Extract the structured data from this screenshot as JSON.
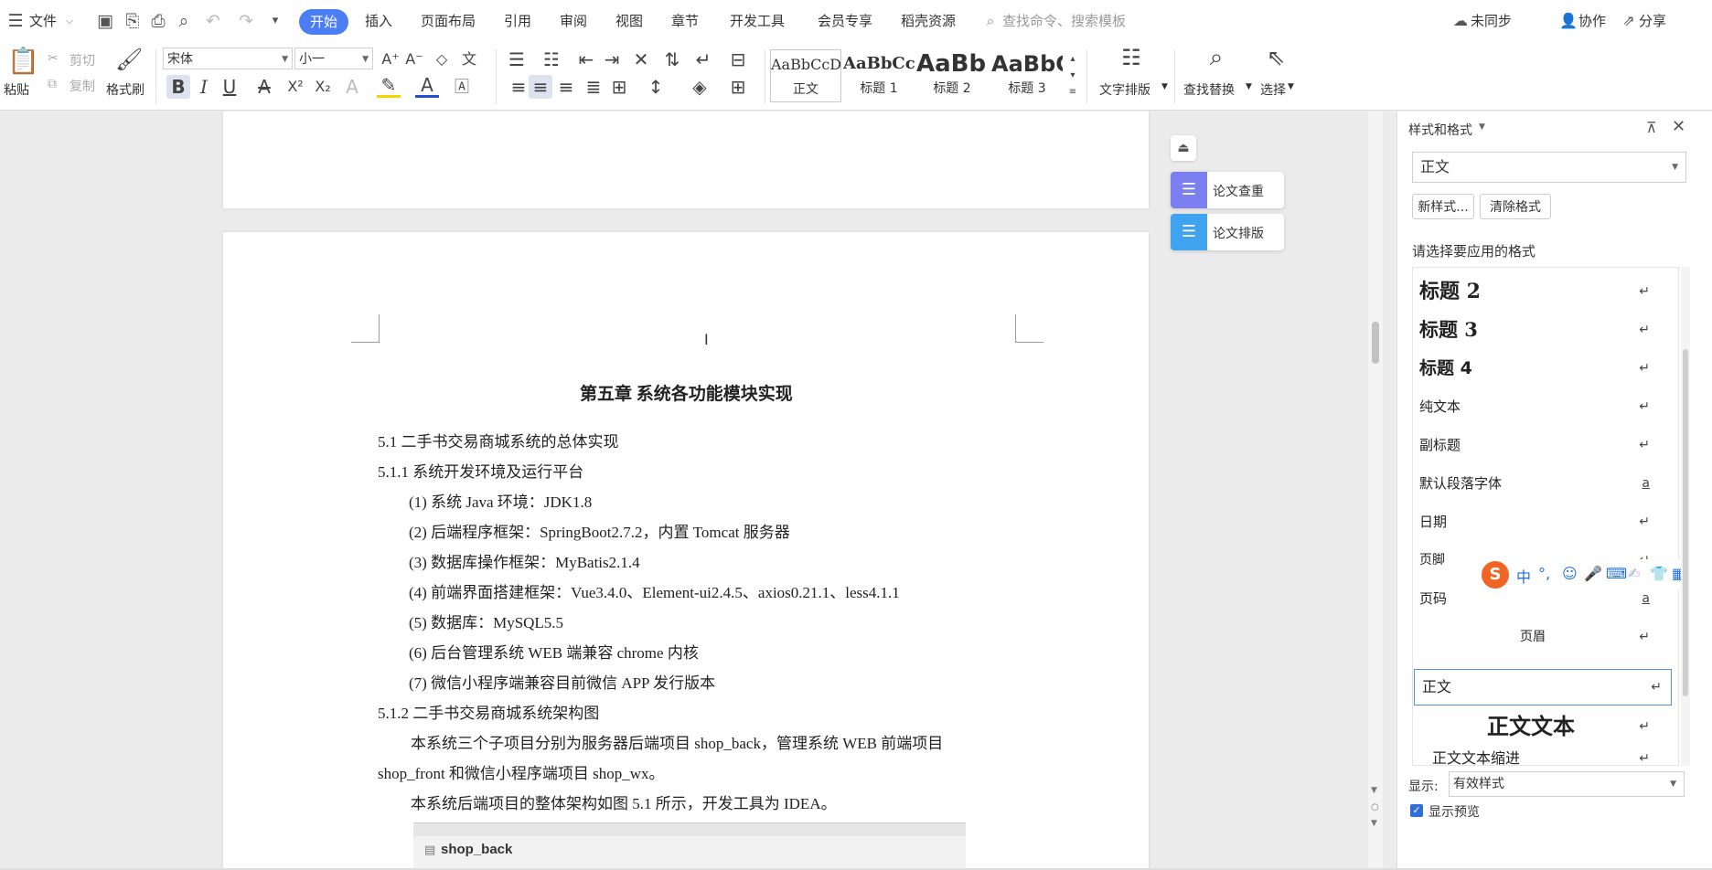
{
  "menubar": {
    "file": "文件",
    "tabs": [
      "开始",
      "插入",
      "页面布局",
      "引用",
      "审阅",
      "视图",
      "章节",
      "开发工具",
      "会员专享",
      "稻壳资源"
    ],
    "search_placeholder": "查找命令、搜索模板",
    "right": {
      "sync": "未同步",
      "collab": "协作",
      "share": "分享"
    }
  },
  "ribbon": {
    "paste": "粘贴",
    "cut": "剪切",
    "copy": "复制",
    "format_painter": "格式刷",
    "font_name": "宋体",
    "font_size": "小一",
    "styles": [
      {
        "preview": "AaBbCcDd",
        "name": "正文"
      },
      {
        "preview": "AaBbCcI",
        "name": "标题 1"
      },
      {
        "preview": "AaBb(",
        "name": "标题 2"
      },
      {
        "preview": "AaBbC",
        "name": "标题 3"
      }
    ],
    "text_layout": "文字排版",
    "find_replace": "查找替换",
    "select": "选择"
  },
  "side_tools": {
    "check": "论文查重",
    "layout": "论文排版"
  },
  "document": {
    "chapter_title": "第五章  系统各功能模块实现",
    "lines": [
      "5.1  二手书交易商城系统的总体实现",
      "5.1.1  系统开发环境及运行平台",
      "(1)  系统 Java 环境：JDK1.8",
      "(2)  后端程序框架：SpringBoot2.7.2，内置 Tomcat 服务器",
      "(3)  数据库操作框架：MyBatis2.1.4",
      "(4)  前端界面搭建框架：Vue3.4.0、Element-ui2.4.5、axios0.21.1、less4.1.1",
      "(5)  数据库：MySQL5.5",
      "(6)  后台管理系统 WEB 端兼容 chrome 内核",
      "(7)  微信小程序端兼容目前微信 APP 发行版本",
      "5.1.2  二手书交易商城系统架构图",
      "本系统三个子项目分别为服务器后端项目 shop_back，管理系统 WEB 前端项目",
      "shop_front 和微信小程序端项目 shop_wx。",
      "本系统后端项目的整体架构如图 5.1 所示，开发工具为 IDEA。"
    ],
    "image_caption": "shop_back"
  },
  "pane": {
    "title": "样式和格式",
    "current_style": "正文",
    "new_style": "新样式...",
    "clear_format": "清除格式",
    "prompt": "请选择要应用的格式",
    "styles": [
      {
        "name": "标题  2",
        "mark": "↵"
      },
      {
        "name": "标题  3",
        "mark": "↵"
      },
      {
        "name": "标题  4",
        "mark": "↵"
      },
      {
        "name": "纯文本",
        "mark": "↵"
      },
      {
        "name": "副标题",
        "mark": "↵"
      },
      {
        "name": "默认段落字体",
        "mark": "a"
      },
      {
        "name": "日期",
        "mark": "↵"
      },
      {
        "name": "页脚",
        "mark": "↵"
      },
      {
        "name": "页码",
        "mark": "a"
      },
      {
        "name": "页眉",
        "mark": "↵"
      },
      {
        "name": "正文",
        "mark": "↵"
      },
      {
        "name": "正文文本",
        "mark": "↵"
      },
      {
        "name": "正文文本缩进",
        "mark": "↵"
      }
    ],
    "show_label": "显示:",
    "show_value": "有效样式",
    "show_preview": "显示预览"
  },
  "ime": {
    "lang": "中"
  }
}
